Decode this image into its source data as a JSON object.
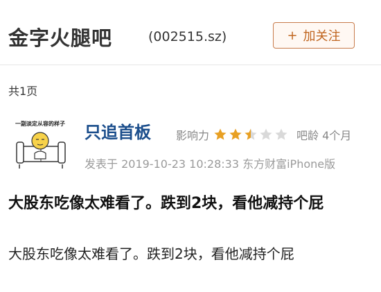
{
  "header": {
    "forum_name": "金字火腿吧",
    "stock_code": "(002515.sz)",
    "follow_label": "加关注"
  },
  "page_count": "共1页",
  "post": {
    "username": "只追首板",
    "influence_label": "影响力",
    "influence_rating": 2.5,
    "influence_max": 5,
    "bar_age": "吧龄 4个月",
    "posted_info": "发表于 2019-10-23 10:28:33 东方财富iPhone版",
    "title": "大股东吃像太难看了。跌到2块，看他减持个屁",
    "body": "大股东吃像太难看了。跌到2块，看他减持个屁",
    "avatar_caption": "一副淡定从容的样子"
  },
  "colors": {
    "accent": "#c0651f",
    "username": "#1b4e8c",
    "star_filled": "#e8a023",
    "star_empty": "#d9d9d9"
  }
}
